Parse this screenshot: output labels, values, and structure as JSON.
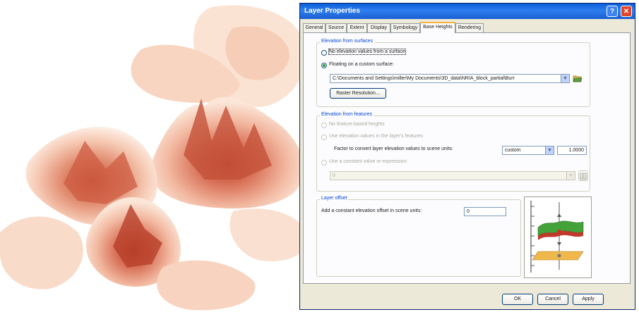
{
  "dialog": {
    "title": "Layer Properties",
    "help_glyph": "?",
    "close_glyph": "✕",
    "tabs": [
      "General",
      "Source",
      "Extent",
      "Display",
      "Symbology",
      "Base Heights",
      "Rendering"
    ],
    "active_tab": "Base Heights"
  },
  "surface_group": {
    "title": "Elevation from surfaces",
    "option_none": "No elevation values from a surface",
    "option_floating": "Floating on a custom surface:",
    "surface_path": "C:\\Documents and Settings\\miller\\My Documents\\3D_data\\NRIA_block_partial\\Burr",
    "raster_button": "Raster Resolution..."
  },
  "features_group": {
    "title": "Elevation from features",
    "option_no_feature": "No feature-based heights",
    "option_use_values": "Use elevation values in the layer's features",
    "factor_label": "Factor to convert layer elevation values to scene units:",
    "unit_value": "custom",
    "factor_value": "1.0000",
    "expression_label": "Use a constant value or expression:",
    "expression_value": "0"
  },
  "offset_group": {
    "title": "Layer offset",
    "offset_label": "Add a constant elevation offset in scene units:",
    "offset_value": "0"
  },
  "footer": {
    "ok": "OK",
    "cancel": "Cancel",
    "apply": "Apply"
  },
  "icons": {
    "open_folder": "open-folder-icon",
    "calculator": "expression-calculator-icon",
    "diagram": "layer-offset-diagram"
  },
  "colors": {
    "title_bar": "#0a5fd8",
    "accent_green": "#21a121",
    "terrain_dark": "#b8402a",
    "terrain_light": "#fbe6d8"
  }
}
